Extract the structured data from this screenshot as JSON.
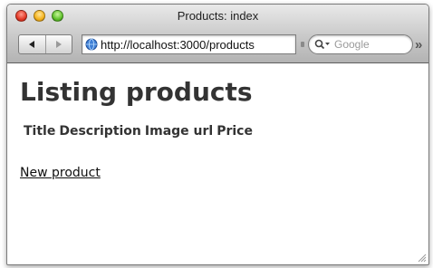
{
  "window": {
    "title": "Products: index"
  },
  "toolbar": {
    "back_icon": "back-arrow-icon",
    "forward_icon": "forward-arrow-icon",
    "url": "http://localhost:3000/products",
    "search_placeholder": "Google",
    "overflow": "»"
  },
  "page": {
    "heading": "Listing products",
    "columns": [
      "Title",
      "Description",
      "Image url",
      "Price"
    ],
    "new_link": "New product"
  }
}
